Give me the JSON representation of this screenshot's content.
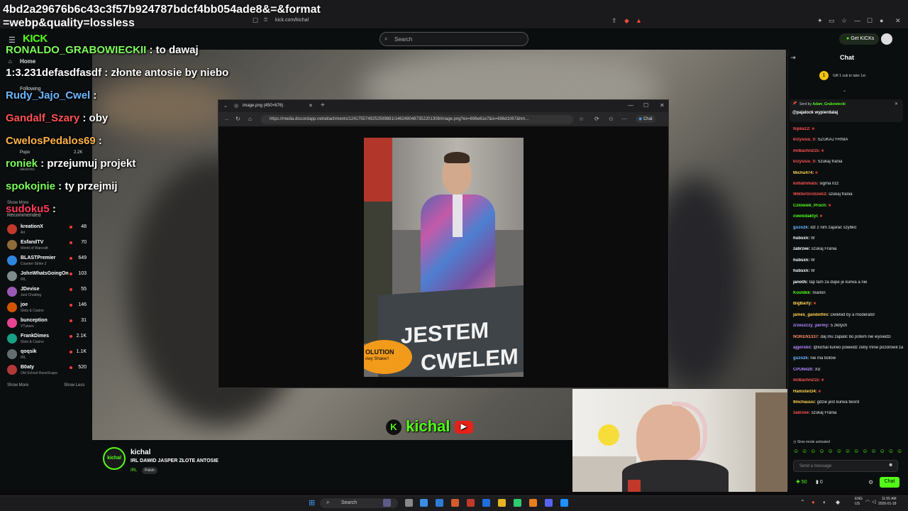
{
  "overlay_url": {
    "line1": "4bd2a29676b6c43c3f57b924787bdcf4bb054ade8&=&format",
    "line2": "=webp&quality=lossless"
  },
  "browser": {
    "url": "kick.com/kichal"
  },
  "header": {
    "logo": "KICK",
    "search_placeholder": "Search",
    "get_kicks": "Get KICKs"
  },
  "sidebar": {
    "home": "Home",
    "following": "Following",
    "show_more": "Show More",
    "recommended_label": "Recommended",
    "following_list": [
      {
        "name": "Popo",
        "viewers": "2.2K"
      },
      {
        "name": "aikolemis",
        "viewers": ""
      }
    ],
    "recommended": [
      {
        "name": "kreationX",
        "category": "Art",
        "viewers": "48",
        "color": "#c0392b"
      },
      {
        "name": "EsfandTV",
        "category": "World of Warcraft",
        "viewers": "70",
        "color": "#8e6b3a"
      },
      {
        "name": "BLASTPremier",
        "category": "Counter-Strike 2",
        "viewers": "649",
        "color": "#2e86de"
      },
      {
        "name": "JohnWhatsGoingOn",
        "category": "IRL",
        "viewers": "103",
        "color": "#7f8c8d"
      },
      {
        "name": "JDevise",
        "category": "Just Chatting",
        "viewers": "55",
        "color": "#9b59b6"
      },
      {
        "name": "joe",
        "category": "Slots & Casino",
        "viewers": "146",
        "color": "#d35400"
      },
      {
        "name": "bunception",
        "category": "VTubers",
        "viewers": "31",
        "color": "#e84393"
      },
      {
        "name": "FrankDimes",
        "category": "Slots & Casino",
        "viewers": "2.1K",
        "color": "#16a085"
      },
      {
        "name": "qoqsik",
        "category": "IRL",
        "viewers": "1.1K",
        "color": "#636e72"
      },
      {
        "name": "B0aty",
        "category": "Old School RuneScape",
        "viewers": "520",
        "color": "#b33939"
      }
    ],
    "show_less": "Show Less"
  },
  "overlay_chat": [
    {
      "user": "RONALDO_GRABOWIECKII",
      "text": " : to dawaj",
      "color": "#7CFC5A"
    },
    {
      "user": "1:3.231defasdfasdf",
      "text": " : złonte antosie by niebo",
      "color": "#ffffff"
    },
    {
      "user": "Rudy_Jajo_Cwel",
      "text": " : ",
      "color": "#6ab7ff"
    },
    {
      "user": "Gandalf_Szary",
      "text": " : oby",
      "color": "#ff5252"
    },
    {
      "user": "CwelosPedalos69",
      "text": " : ",
      "color": "#ffb347"
    },
    {
      "user": "roniek",
      "text": " : przejumuj projekt",
      "color": "#7CFC5A"
    },
    {
      "user": "spokojnie",
      "text": " : ty przejmij",
      "color": "#7CFC5A"
    },
    {
      "user": "sudoku5",
      "text": " : ",
      "color": "#ff3b5c"
    }
  ],
  "viewer": {
    "tab_title": "image.png (450×676)",
    "url": "https://media.discordapp.net/attachments/1241755749252599881/1462490487352201308/image.png?ex=696e61e7&is=696d1067&hm...",
    "chat_label": "Chat",
    "sign_line1": "JESTEM",
    "sign_line2": "CWELEM",
    "sticker_line1": "OLUTION",
    "sticker_line2": "owy Shaker!"
  },
  "watermark": "kichal",
  "streamer": {
    "name": "kichal",
    "title": "IRL DAWID JASPER ZŁOTE ANTOSIE",
    "category": "IRL",
    "tag": "Polish",
    "avatar_text": "kichal"
  },
  "chat": {
    "title": "Chat",
    "gift_text": "Gift 1 sub to take 1st",
    "pinned_sender_prefix": "Sent by",
    "pinned_sender": "Adam_Grabowiecki",
    "pinned_text": "@pajalock wypierdalaj",
    "messages": [
      {
        "user": "topka12:",
        "text": "",
        "color": "#ff5252"
      },
      {
        "user": "krzysiuu_0:",
        "text": "SZUKAJ FRNIA",
        "color": "#ff5252"
      },
      {
        "user": "mrBachn215:",
        "text": "",
        "color": "#ff5252"
      },
      {
        "user": "krzysiuu_0:",
        "text": "Szukaj frania",
        "color": "#ff5252"
      },
      {
        "user": "Michu474:",
        "text": "",
        "color": "#ffd54f"
      },
      {
        "user": "kotlatnmats:",
        "text": "sigma rizz",
        "color": "#ff5252"
      },
      {
        "user": "WiktorGroSzek3:",
        "text": "szukaj frania",
        "color": "#ff5252"
      },
      {
        "user": "Czlowiek_Proch:",
        "text": "",
        "color": "#53fc18"
      },
      {
        "user": "cwelodaktyl:",
        "text": "",
        "color": "#53fc18"
      },
      {
        "user": "guzo2k:",
        "text": "idź z nim zajarać szybko",
        "color": "#6ab7ff"
      },
      {
        "user": "hubsxn:",
        "text": "W",
        "color": "#ffffff"
      },
      {
        "user": "zabrzee:",
        "text": "szukaj Frania",
        "color": "#ffffff"
      },
      {
        "user": "hubsxn:",
        "text": "W",
        "color": "#ffffff"
      },
      {
        "user": "hubsxn:",
        "text": "W",
        "color": "#ffffff"
      },
      {
        "user": "jano05:",
        "text": "tap tam za dupe je kurwa a nie",
        "color": "#ffffff"
      },
      {
        "user": "Kostdkk:",
        "text": "marlon",
        "color": "#53fc18"
      },
      {
        "user": "BigBarty:",
        "text": "",
        "color": "#ffd54f"
      },
      {
        "user": "james_gandolfini:",
        "text": "Deleted by a moderator",
        "color": "#ffd54f"
      },
      {
        "user": "zrzeszczy_permy:",
        "text": "5 złotych",
        "color": "#b388ff"
      },
      {
        "user": "NOKEN1337:",
        "text": "daj mu zapalić bo potem nie wysiedzi",
        "color": "#ff8a65"
      },
      {
        "user": "ajgorskii:",
        "text": "@kichal kurwo powiedz żeby mnie pozdrowił zasłużyłem na to",
        "color": "#b388ff"
      },
      {
        "user": "guzo2k:",
        "text": "nie ma botów",
        "color": "#6ab7ff"
      },
      {
        "user": "CPUN420:",
        "text": "Xd",
        "color": "#b388ff"
      },
      {
        "user": "mrBachn215:",
        "text": "",
        "color": "#ff5252"
      },
      {
        "user": "HamsterD4:",
        "text": "",
        "color": "#ffd54f"
      },
      {
        "user": "9mchauuu:",
        "text": "gdzie jest kurwa tword",
        "color": "#ffd54f"
      },
      {
        "user": "zabrzee:",
        "text": "szukaj Frania",
        "color": "#ff5252"
      }
    ],
    "slow_mode": "Slow mode activated",
    "input_placeholder": "Send a message",
    "kicks_count": "50",
    "sub_count": "0",
    "chat_button": "Chat"
  },
  "taskbar": {
    "search": "Search",
    "lang_line1": "ENG",
    "lang_line2": "US",
    "time": "11:55 AM",
    "date": "2026-01-18"
  }
}
